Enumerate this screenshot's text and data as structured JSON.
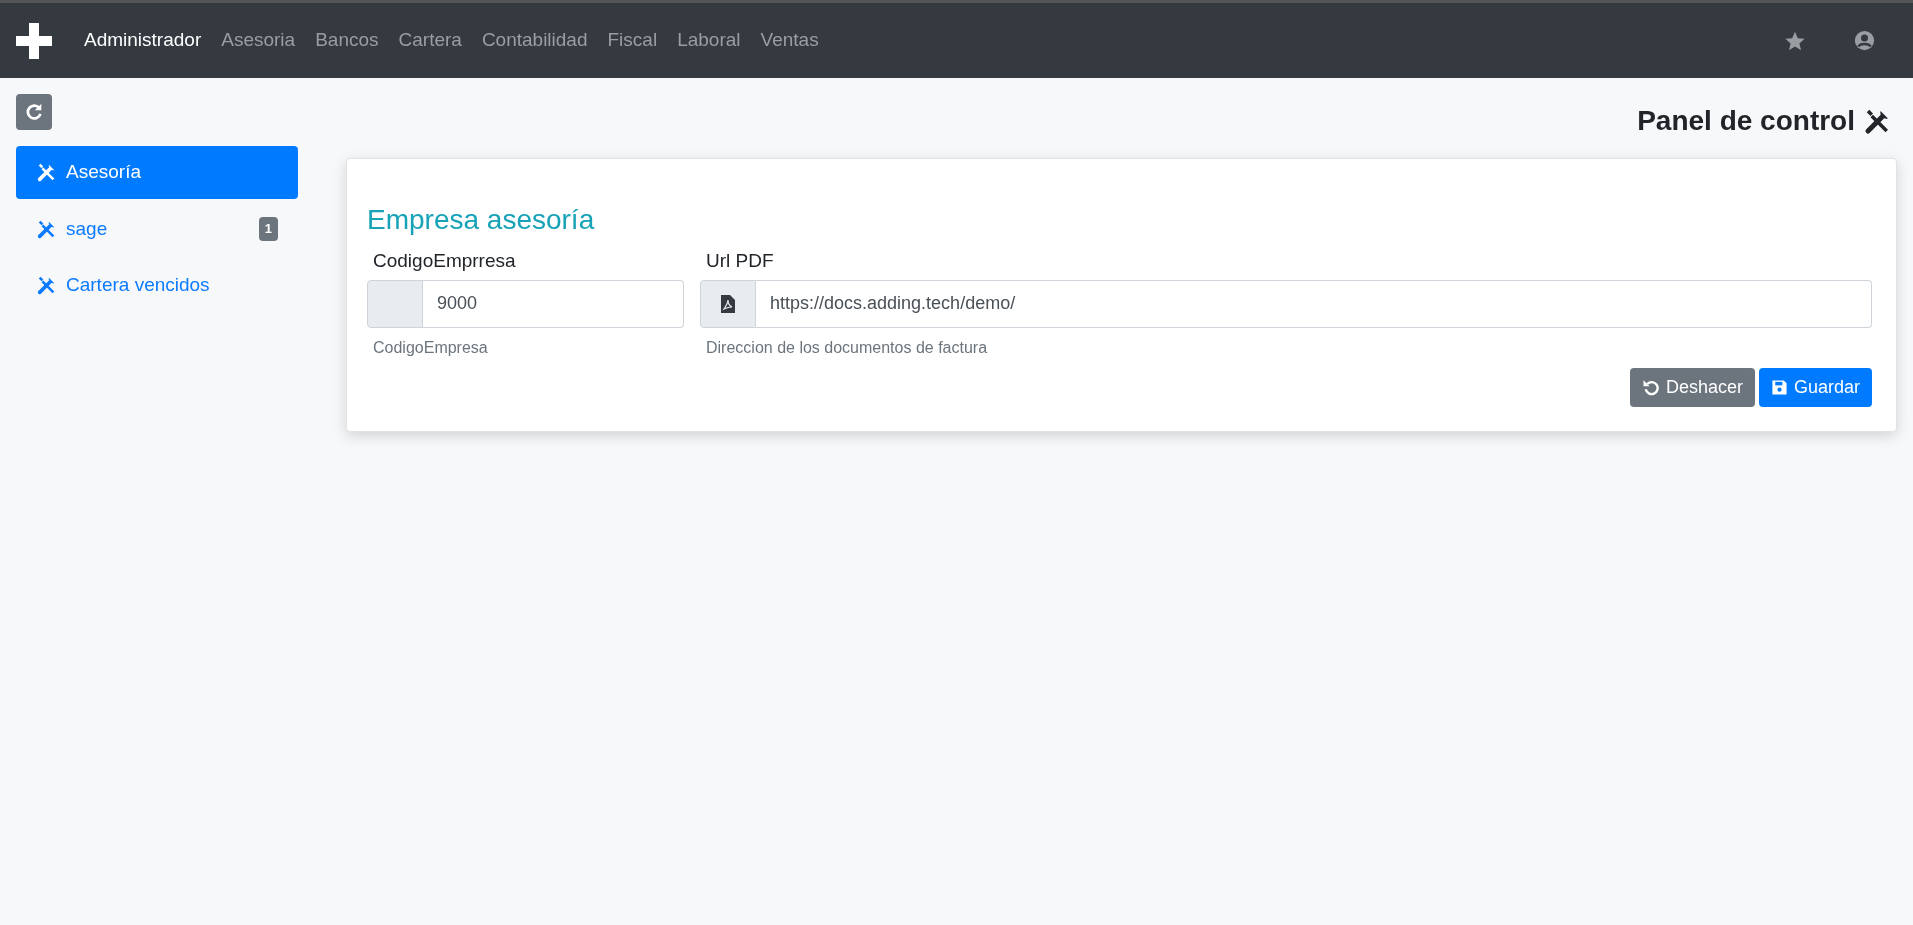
{
  "navbar": {
    "items": [
      {
        "label": "Administrador",
        "selected": true
      },
      {
        "label": "Asesoria",
        "selected": false
      },
      {
        "label": "Bancos",
        "selected": false
      },
      {
        "label": "Cartera",
        "selected": false
      },
      {
        "label": "Contabilidad",
        "selected": false
      },
      {
        "label": "Fiscal",
        "selected": false
      },
      {
        "label": "Laboral",
        "selected": false
      },
      {
        "label": "Ventas",
        "selected": false
      }
    ]
  },
  "page_title": "Panel de control",
  "sidebar": {
    "items": [
      {
        "label": "Asesoría",
        "selected": true
      },
      {
        "label": "sage",
        "selected": false,
        "badge": "1"
      },
      {
        "label": "Cartera vencidos",
        "selected": false
      }
    ]
  },
  "card": {
    "title": "Empresa asesoría",
    "fields": [
      {
        "kind": "plain",
        "label": "CodigoEmprresa",
        "value": "9000",
        "help": "CodigoEmpresa"
      },
      {
        "kind": "pdf",
        "label": "Url PDF",
        "value": "https://docs.adding.tech/demo/",
        "help": "Direccion de los documentos de factura"
      }
    ],
    "buttons": [
      {
        "kind": "undo",
        "label": "Deshacer"
      },
      {
        "kind": "save",
        "label": "Guardar"
      }
    ]
  }
}
